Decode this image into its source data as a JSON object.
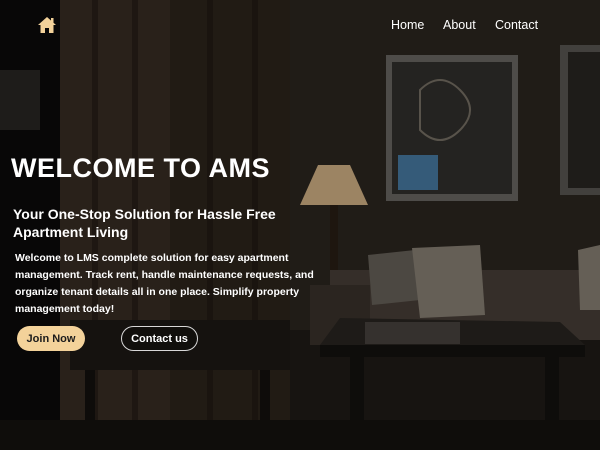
{
  "nav": {
    "home_icon": "home-icon",
    "links": [
      "Home",
      "About",
      "Contact"
    ]
  },
  "hero": {
    "title": "WELCOME TO AMS",
    "subtitle": "Your One-Stop Solution for Hassle Free Apartment Living",
    "description": "Welcome to LMS complete solution for easy apartment management. Track rent, handle maintenance requests, and organize tenant details all in one place. Simplify property management today!",
    "join_label": "Join Now",
    "contact_label": "Contact us"
  },
  "colors": {
    "accent": "#f3d29a",
    "text": "#ffffff",
    "background": "#1a1612"
  }
}
